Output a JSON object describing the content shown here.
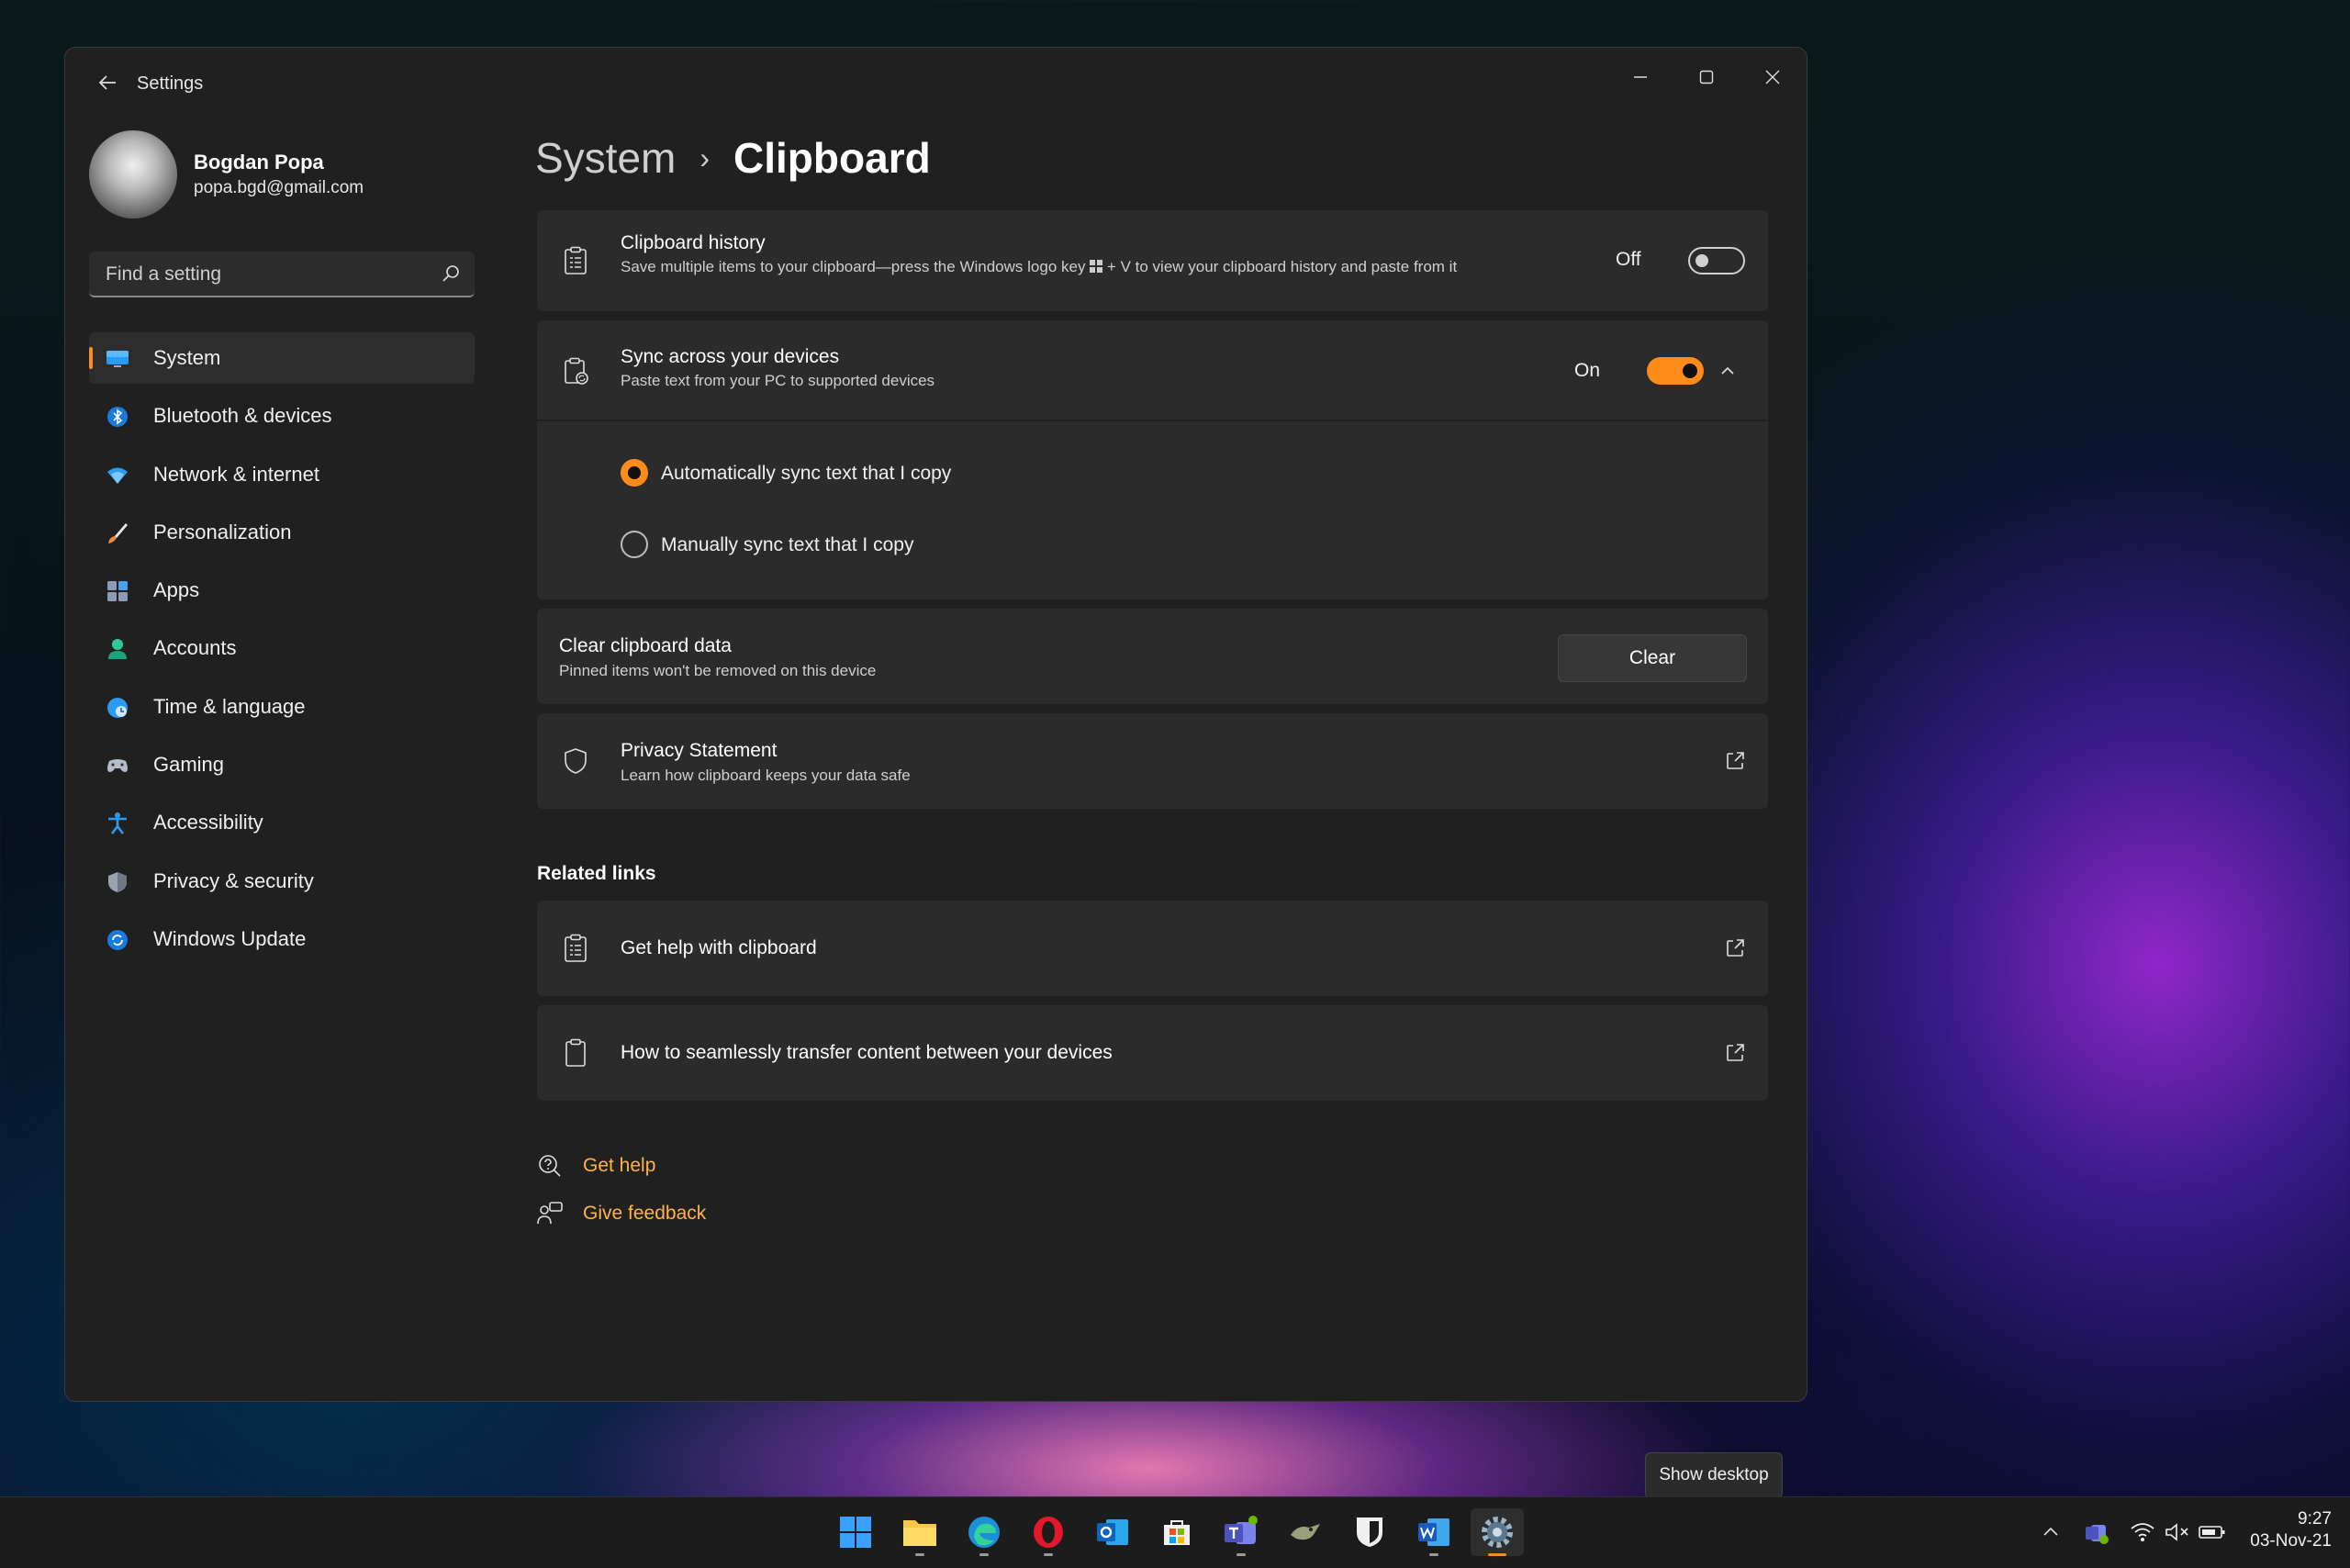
{
  "window": {
    "title": "Settings"
  },
  "profile": {
    "name": "Bogdan Popa",
    "email": "popa.bgd@gmail.com"
  },
  "search": {
    "placeholder": "Find a setting"
  },
  "nav": [
    {
      "label": "System",
      "icon": "system-monitor-icon",
      "active": true
    },
    {
      "label": "Bluetooth & devices",
      "icon": "bluetooth-icon"
    },
    {
      "label": "Network & internet",
      "icon": "wifi-icon"
    },
    {
      "label": "Personalization",
      "icon": "brush-icon"
    },
    {
      "label": "Apps",
      "icon": "apps-icon"
    },
    {
      "label": "Accounts",
      "icon": "person-icon"
    },
    {
      "label": "Time & language",
      "icon": "globe-clock-icon"
    },
    {
      "label": "Gaming",
      "icon": "gamepad-icon"
    },
    {
      "label": "Accessibility",
      "icon": "accessibility-icon"
    },
    {
      "label": "Privacy & security",
      "icon": "shield-icon"
    },
    {
      "label": "Windows Update",
      "icon": "update-icon"
    }
  ],
  "breadcrumb": {
    "parent": "System",
    "separator": "›",
    "current": "Clipboard"
  },
  "clipboard_history": {
    "title": "Clipboard history",
    "desc_before": "Save multiple items to your clipboard—press the Windows logo key",
    "desc_after": "+ V to view your clipboard history and paste from it",
    "state": "Off"
  },
  "sync": {
    "title": "Sync across your devices",
    "desc": "Paste text from your PC to supported devices",
    "state": "On",
    "options": [
      {
        "label": "Automatically sync text that I copy",
        "selected": true
      },
      {
        "label": "Manually sync text that I copy",
        "selected": false
      }
    ]
  },
  "clear": {
    "title": "Clear clipboard data",
    "desc": "Pinned items won't be removed on this device",
    "button": "Clear"
  },
  "privacy": {
    "title": "Privacy Statement",
    "desc": "Learn how clipboard keeps your data safe"
  },
  "related": {
    "heading": "Related links",
    "links": [
      {
        "label": "Get help with clipboard"
      },
      {
        "label": "How to seamlessly transfer content between your devices"
      }
    ]
  },
  "footer": {
    "get_help": "Get help",
    "give_feedback": "Give feedback"
  },
  "tooltip": "Show desktop",
  "taskbar": {
    "apps": [
      "start-icon",
      "file-explorer-icon",
      "edge-icon",
      "opera-icon",
      "outlook-icon",
      "store-icon",
      "teams-icon",
      "app-icon",
      "bitwarden-icon",
      "word-icon",
      "settings-icon"
    ],
    "clock": {
      "time": "9:27",
      "date": "03-Nov-21"
    }
  },
  "colors": {
    "accent": "#ff8c1a",
    "link": "#ffb347",
    "card": "#2b2b2b",
    "window": "#202020"
  }
}
